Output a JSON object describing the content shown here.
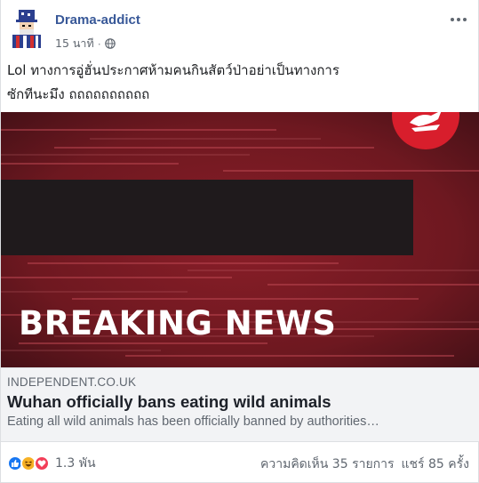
{
  "post": {
    "author": "Drama-addict",
    "time": "15 นาที",
    "separator": "·",
    "privacy_icon": "globe-icon",
    "more_icon": "more-dots-icon",
    "text_line1": "Lol ทางการอู่ฮั่นประกาศห้ามคนกินสัตว์ป่าอย่าเป็นทางการ",
    "text_line2": "ซักทีนะมึง ถถถถถถถถถถ"
  },
  "media": {
    "headline": "BREAKING NEWS",
    "logo_icon": "independent-eagle-logo-icon",
    "colors": {
      "background": "#6e1a22",
      "banner": "#1f1a1c",
      "logo": "#d81e2c"
    }
  },
  "link": {
    "domain": "INDEPENDENT.CO.UK",
    "title": "Wuhan officially bans eating wild animals",
    "description": "Eating all wild animals has been officially banned by authorities…"
  },
  "footer": {
    "reaction_icons": [
      "like-icon",
      "haha-icon",
      "love-icon"
    ],
    "reaction_count": "1.3 พัน",
    "comments": "ความคิดเห็น 35 รายการ",
    "shares": "แชร์ 85 ครั้ง"
  },
  "colors": {
    "author_link": "#385898",
    "like": "#1877f2",
    "haha": "#f7b125",
    "love": "#f33e58"
  }
}
